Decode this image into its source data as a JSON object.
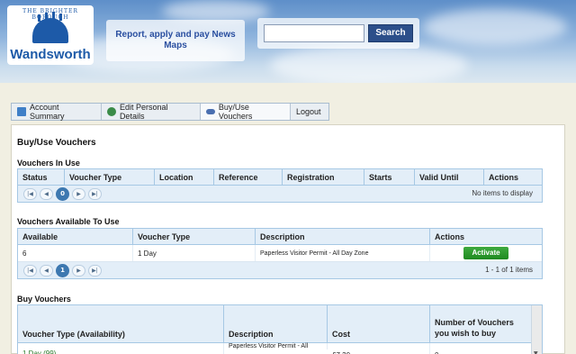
{
  "header": {
    "logo": {
      "arc_text": "THE BRIGHTER BOROUGH",
      "name": "Wandsworth"
    },
    "nav_line1": "Report, apply and pay   News",
    "nav_line2": "Maps",
    "search": {
      "value": "",
      "button_label": "Search"
    }
  },
  "tabs": [
    {
      "label": "Account Summary",
      "icon": "account-icon",
      "color": "#3f7fc7"
    },
    {
      "label": "Edit Personal Details",
      "icon": "person-icon",
      "color": "#3a8b48"
    },
    {
      "label": "Buy/Use Vouchers",
      "icon": "car-icon",
      "color": "#4a6fb0"
    },
    {
      "label": "Logout",
      "icon": "",
      "color": ""
    }
  ],
  "page_title": "Buy/Use Vouchers",
  "in_use": {
    "heading": "Vouchers In Use",
    "columns": [
      "Status",
      "Voucher Type",
      "Location",
      "Reference",
      "Registration",
      "Starts",
      "Valid Until",
      "Actions"
    ],
    "current_page": "0",
    "pager_info": "No items to display"
  },
  "available": {
    "heading": "Vouchers Available To Use",
    "columns": [
      "Available",
      "Voucher Type",
      "Description",
      "Actions"
    ],
    "rows": [
      {
        "available": "6",
        "voucher_type": "1 Day",
        "description": "Paperless Visitor Permit - All Day Zone",
        "action": "Activate"
      }
    ],
    "current_page": "1",
    "pager_info": "1 - 1 of 1 items"
  },
  "buy": {
    "heading": "Buy Vouchers",
    "columns": [
      "Voucher Type (Availability)",
      "Description",
      "Cost",
      "Number of Vouchers you wish to buy"
    ],
    "rows": [
      {
        "voucher_type": "1 Day (99)",
        "description": "Paperless Visitor Permit - All",
        "cost": "£7.30",
        "qty": "0"
      }
    ]
  },
  "colors": {
    "accent": "#3d78b0",
    "button_green": "#2a9a2c",
    "search_button": "#2c4f8a"
  }
}
